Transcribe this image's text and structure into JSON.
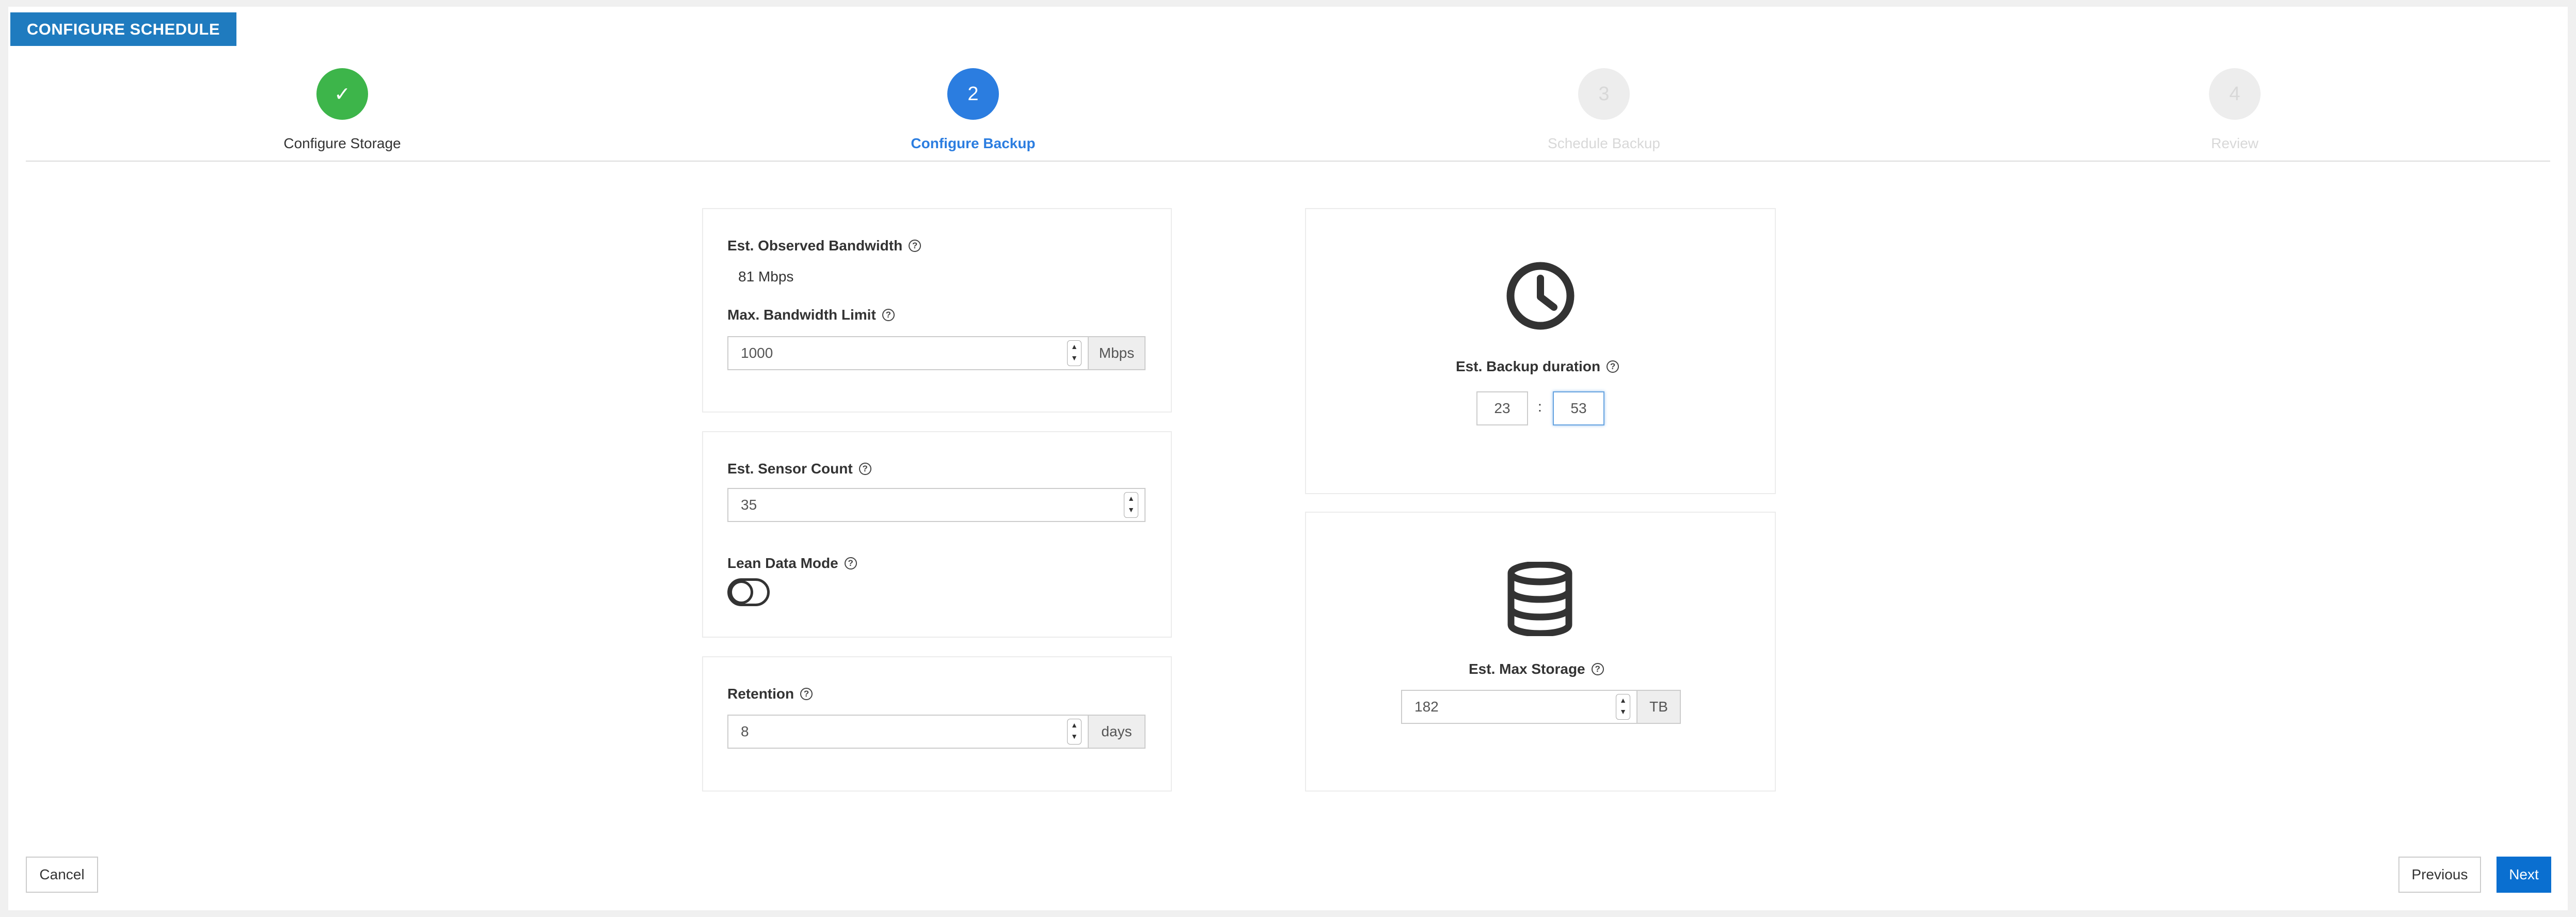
{
  "header": {
    "title": "CONFIGURE SCHEDULE"
  },
  "steps": [
    {
      "number": "✓",
      "label": "Configure Storage",
      "state": "done"
    },
    {
      "number": "2",
      "label": "Configure Backup",
      "state": "active"
    },
    {
      "number": "3",
      "label": "Schedule Backup",
      "state": "pending"
    },
    {
      "number": "4",
      "label": "Review",
      "state": "pending"
    }
  ],
  "bandwidth": {
    "observed_label": "Est. Observed Bandwidth",
    "observed_value": "81 Mbps",
    "limit_label": "Max. Bandwidth Limit",
    "limit_value": "1000",
    "limit_unit": "Mbps"
  },
  "sensors": {
    "count_label": "Est. Sensor Count",
    "count_value": "35",
    "lean_label": "Lean Data Mode",
    "lean_enabled": false
  },
  "retention": {
    "label": "Retention",
    "value": "8",
    "unit": "days"
  },
  "duration": {
    "icon": "clock-icon",
    "label": "Est. Backup duration",
    "hours": "23",
    "separator": ":",
    "minutes": "53"
  },
  "storage": {
    "icon": "database-icon",
    "label": "Est. Max Storage",
    "value": "182",
    "unit": "TB"
  },
  "footer": {
    "cancel_label": "Cancel",
    "previous_label": "Previous",
    "next_label": "Next"
  },
  "help_glyph": "?",
  "colors": {
    "header": "#1f7bbf",
    "step_done": "#3db54a",
    "step_active": "#2b7de0",
    "primary_button": "#0a6fd0"
  }
}
